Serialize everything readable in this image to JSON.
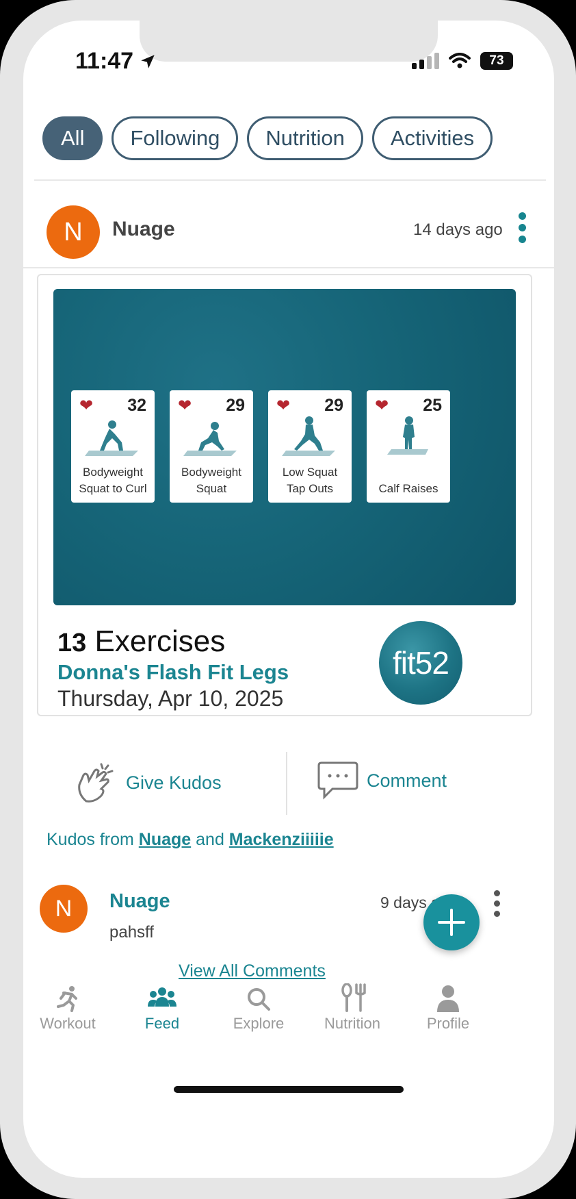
{
  "status_bar": {
    "time": "11:47",
    "battery": "73"
  },
  "filters": [
    {
      "label": "All",
      "active": true
    },
    {
      "label": "Following",
      "active": false
    },
    {
      "label": "Nutrition",
      "active": false
    },
    {
      "label": "Activities",
      "active": false
    }
  ],
  "post": {
    "avatar_letter": "N",
    "username": "Nuage",
    "time_ago": "14 days ago",
    "exercise_cards": [
      {
        "count": "32",
        "name_line1": "Bodyweight",
        "name_line2": "Squat to Curl"
      },
      {
        "count": "29",
        "name_line1": "Bodyweight",
        "name_line2": "Squat"
      },
      {
        "count": "29",
        "name_line1": "Low Squat",
        "name_line2": "Tap Outs"
      },
      {
        "count": "25",
        "name_line1": "",
        "name_line2": "Calf Raises"
      }
    ],
    "exercise_count": "13",
    "exercise_count_label": "Exercises",
    "workout_title": "Donna's Flash Fit Legs",
    "date": "Thursday, Apr 10, 2025",
    "brand_logo_text": "fit52"
  },
  "actions": {
    "kudos_label": "Give Kudos",
    "comment_label": "Comment"
  },
  "kudos": {
    "prefix": "Kudos from ",
    "user1": "Nuage",
    "joiner": " and ",
    "user2": "Mackenziiiiie"
  },
  "comment": {
    "avatar_letter": "N",
    "username": "Nuage",
    "text": "pahsff",
    "time_ago": "9 days ago",
    "view_all": "View All Comments"
  },
  "fab_icon": "plus-icon",
  "nav": [
    {
      "label": "Workout",
      "icon": "running-icon",
      "active": false
    },
    {
      "label": "Feed",
      "icon": "people-icon",
      "active": true
    },
    {
      "label": "Explore",
      "icon": "search-icon",
      "active": false
    },
    {
      "label": "Nutrition",
      "icon": "fork-knife-icon",
      "active": false
    },
    {
      "label": "Profile",
      "icon": "person-icon",
      "active": false
    }
  ],
  "colors": {
    "accent": "#1b8591",
    "chip_active": "#466277",
    "avatar": "#ec6a0f",
    "heart": "#b5262f",
    "image_bg": "#166578"
  }
}
